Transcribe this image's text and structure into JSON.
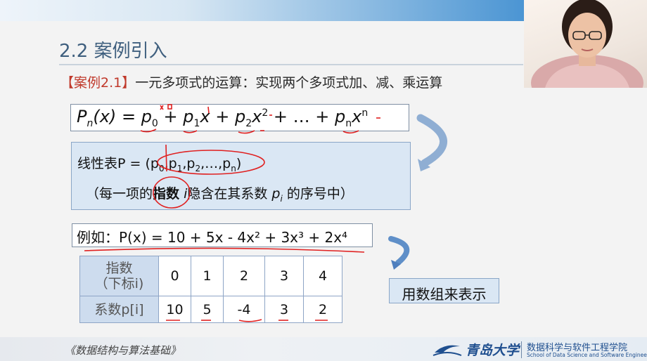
{
  "slide": {
    "title": "2.2 案例引入",
    "case_tag": "【案例2.1】",
    "case_text": "一元多项式的运算：实现两个多项式加、减、乘运算",
    "polynomial": {
      "lhs": "Pn(x)",
      "eq": "=",
      "t0": "p0",
      "t1": "p1x",
      "t2": "p2x2",
      "dots": "+ … +",
      "tn": "pnxn",
      "plus": "+"
    },
    "linear_list": {
      "prefix": "线性表P =",
      "tuple": "(p0,p1,p2,…,pn)",
      "note_open": "（每一项的",
      "note_bold": "指数",
      "note_i": "i",
      "note_mid": "隐含在其系数",
      "note_pi": "pi",
      "note_close": "的序号中）"
    },
    "example": "例如：P(x) = 10 + 5x - 4x² + 3x³ + 2x⁴",
    "table": {
      "header_label": "指数\n（下标i)",
      "header_line1": "指数",
      "header_line2": "（下标i)",
      "row_label": "系数p[i]",
      "indices": [
        "0",
        "1",
        "2",
        "3",
        "4"
      ],
      "coefficients": [
        "10",
        "5",
        "-4",
        "3",
        "2"
      ]
    },
    "array_button": "用数组来表示"
  },
  "footer": {
    "book": "《数据结构与算法基础》",
    "university": "青岛大学",
    "school_cn": "数据科学与软件工程学院",
    "school_en": "School of Data Science and Software Engineering"
  },
  "colors": {
    "title": "#3f5f7e",
    "box_fill": "#dae7f4",
    "table_header": "#cddcee",
    "table_border": "#8ea5c6",
    "annotation_red": "#e02020",
    "case_tag": "#c0392b",
    "brand_blue": "#1f4f8f"
  },
  "icons": {
    "arrow1": "curved-arrow-icon",
    "arrow2": "curved-arrow-icon",
    "webcam": "presenter-video"
  }
}
